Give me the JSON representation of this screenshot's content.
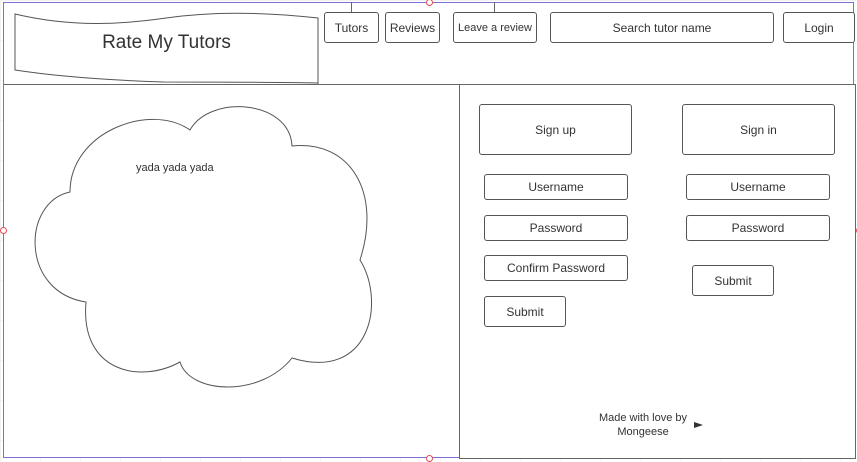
{
  "header": {
    "logo_text": "Rate My Tutors",
    "nav": {
      "tutors": "Tutors",
      "reviews": "Reviews",
      "leave_review": "Leave a review"
    },
    "search_placeholder": "Search tutor name",
    "login": "Login"
  },
  "cloud": {
    "text": "yada yada yada"
  },
  "signup": {
    "title": "Sign up",
    "username": "Username",
    "password": "Password",
    "confirm_password": "Confirm Password",
    "submit": "Submit"
  },
  "signin": {
    "title": "Sign in",
    "username": "Username",
    "password": "Password",
    "submit": "Submit"
  },
  "footer": {
    "text": "Made with love by Mongeese"
  },
  "colors": {
    "selection": "#7b6fd6",
    "handle": "#e04f57"
  }
}
